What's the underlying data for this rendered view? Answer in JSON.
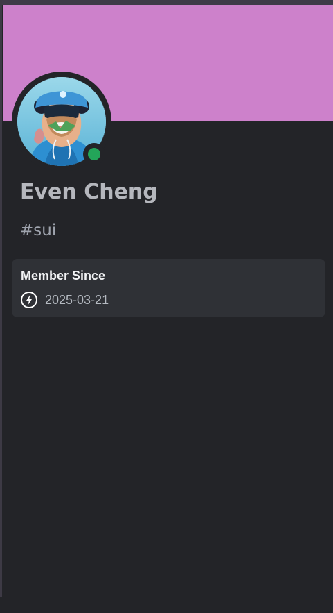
{
  "profile": {
    "display_name": "Even Cheng",
    "username": "#sui",
    "status": "online",
    "status_color": "#23a559",
    "banner_color": "#cd81cb",
    "avatar_icon": "bear-avatar-icon"
  },
  "member_since": {
    "title": "Member Since",
    "icon": "discord-badge-icon",
    "date": "2025-03-21"
  },
  "colors": {
    "background": "#232428",
    "panel": "#2f3136",
    "name_text": "#b5b7bd"
  }
}
